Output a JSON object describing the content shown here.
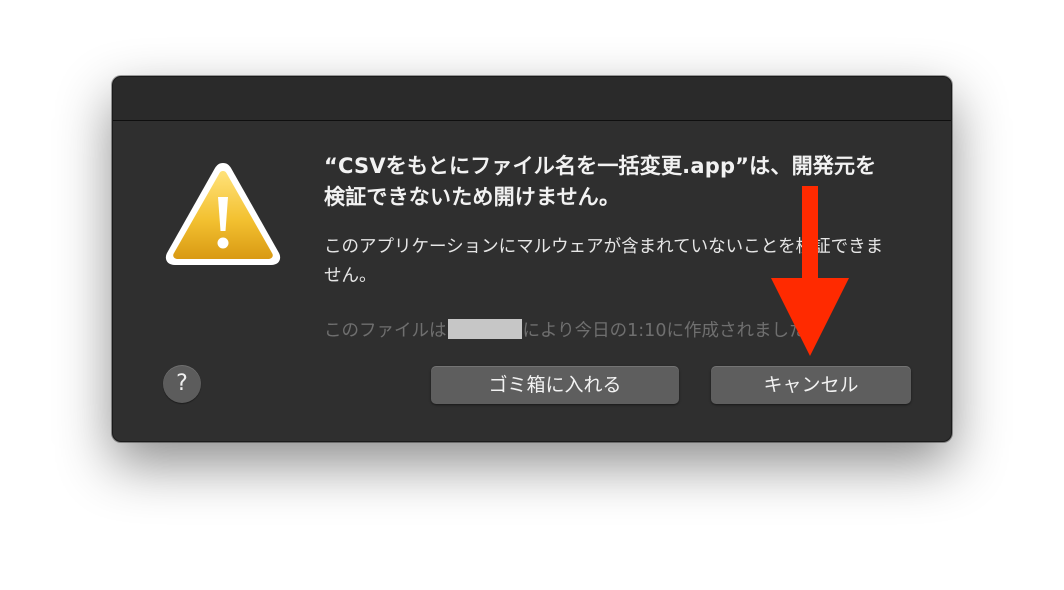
{
  "dialog": {
    "title": "“CSVをもとにファイル名を一括変更.app”は、開発元を検証できないため開けません。",
    "body": "このアプリケーションにマルウェアが含まれていないことを検証できません。",
    "info_prefix": "このファイルは",
    "info_suffix": "により今日の1:10に作成されました。",
    "help_label": "?",
    "move_to_trash_label": "ゴミ箱に入れる",
    "cancel_label": "キャンセル"
  },
  "icons": {
    "warning": "warning-triangle-icon",
    "help": "question-mark-icon",
    "annotation": "red-down-arrow"
  },
  "colors": {
    "dialog_bg": "#2f2f2f",
    "button_bg": "#5e5e5e",
    "warning_fill": "#f2c12e",
    "annotation_arrow": "#ff2a00"
  }
}
